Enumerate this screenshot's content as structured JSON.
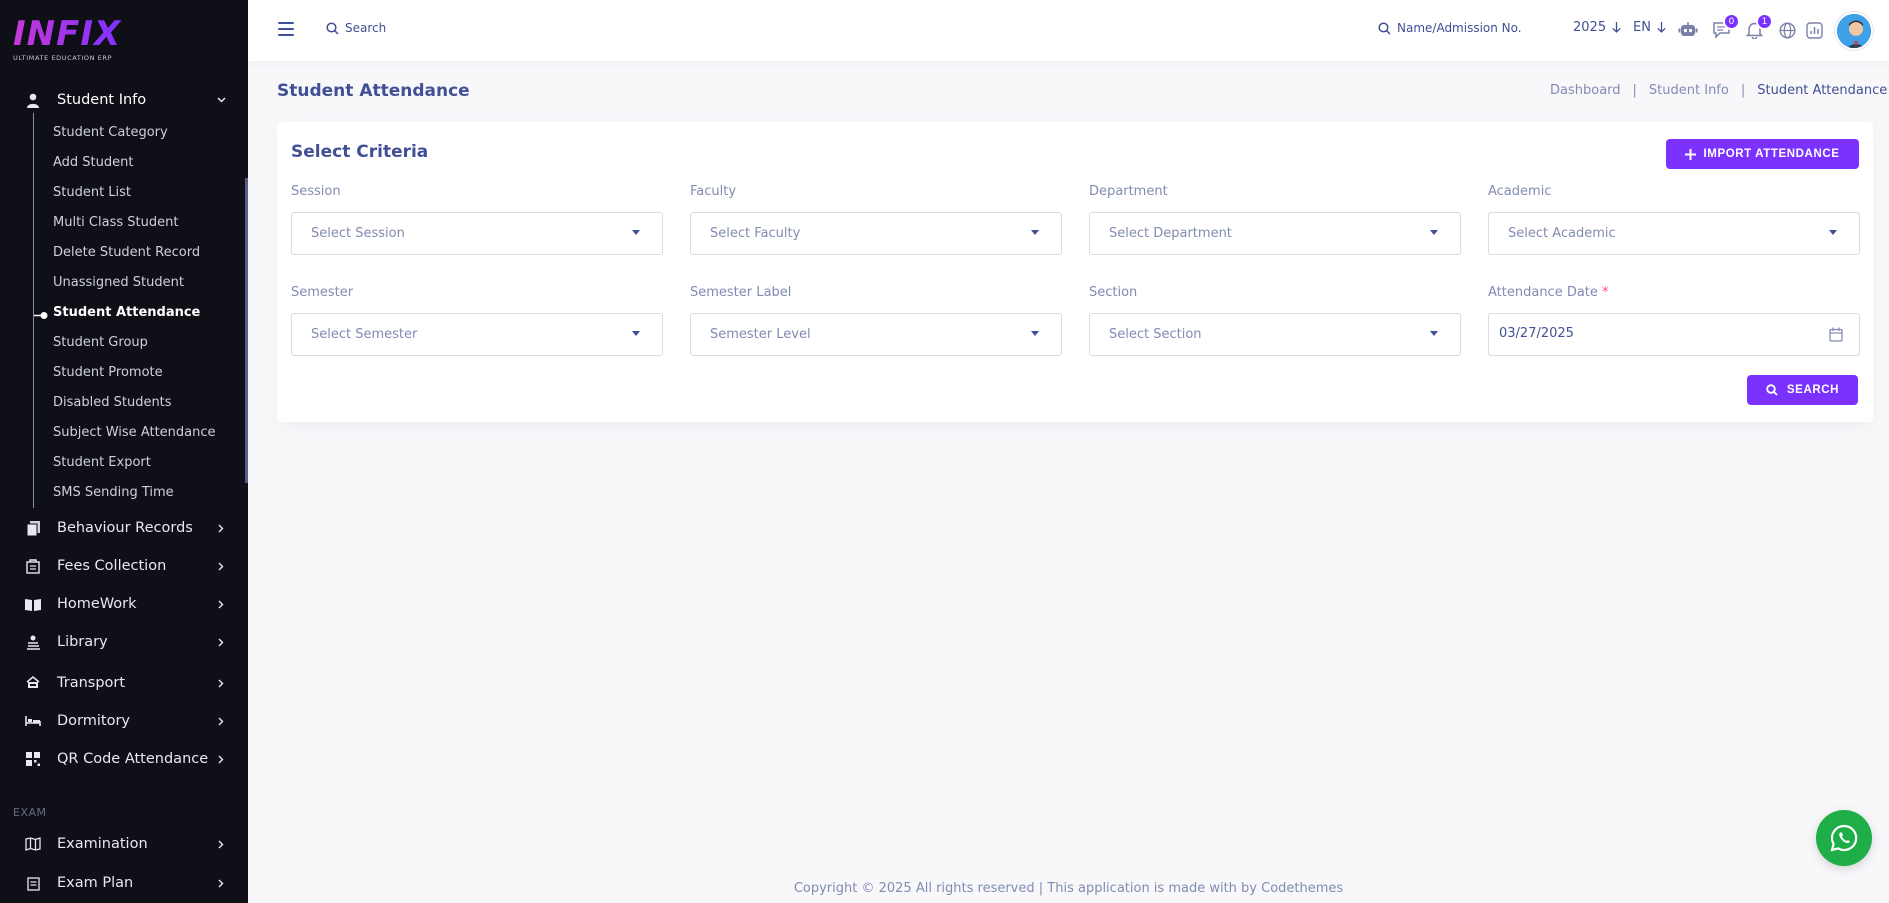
{
  "logo": {
    "text": "INFIX",
    "subtitle": "ULTIMATE EDUCATION ERP"
  },
  "sidebar": {
    "student_info": {
      "label": "Student Info",
      "icon": "user-icon"
    },
    "sub_items": [
      "Student Category",
      "Add Student",
      "Student List",
      "Multi Class Student",
      "Delete Student Record",
      "Unassigned Student",
      "Student Attendance",
      "Student Group",
      "Student Promote",
      "Disabled Students",
      "Subject Wise Attendance",
      "Student Export",
      "SMS Sending Time"
    ],
    "active_sub_item": "Student Attendance",
    "menus": [
      {
        "label": "Behaviour Records",
        "icon": "files-icon"
      },
      {
        "label": "Fees Collection",
        "icon": "receipt-icon"
      },
      {
        "label": "HomeWork",
        "icon": "book-icon"
      },
      {
        "label": "Library",
        "icon": "library-icon"
      },
      {
        "label": "Transport",
        "icon": "bus-icon"
      },
      {
        "label": "Dormitory",
        "icon": "bed-icon"
      },
      {
        "label": "QR Code Attendance",
        "icon": "qrcode-icon"
      }
    ],
    "section_exam": "EXAM",
    "exam_menus": [
      {
        "label": "Examination",
        "icon": "map-icon"
      },
      {
        "label": "Exam Plan",
        "icon": "clipboard-icon"
      }
    ]
  },
  "header": {
    "search_placeholder": "Search",
    "name_search_placeholder": "Name/Admission No.",
    "year": "2025",
    "language": "EN",
    "chat_count": "0",
    "notification_count": "1"
  },
  "page": {
    "title": "Student Attendance",
    "breadcrumb": [
      "Dashboard",
      "Student Info",
      "Student Attendance"
    ]
  },
  "criteria": {
    "title": "Select Criteria",
    "import_button": "IMPORT ATTENDANCE",
    "search_button": "SEARCH",
    "fields": {
      "session": {
        "label": "Session",
        "value": "Select Session"
      },
      "faculty": {
        "label": "Faculty",
        "value": "Select Faculty"
      },
      "department": {
        "label": "Department",
        "value": "Select Department"
      },
      "academic": {
        "label": "Academic",
        "value": "Select Academic"
      },
      "semester": {
        "label": "Semester",
        "value": "Select Semester"
      },
      "semester_label": {
        "label": "Semester Label",
        "value": "Semester Level"
      },
      "section": {
        "label": "Section",
        "value": "Select Section"
      },
      "attendance_date": {
        "label": "Attendance Date",
        "required_mark": "*",
        "value": "03/27/2025"
      }
    }
  },
  "footer": {
    "text": "Copyright © 2025 All rights reserved | This application is made with by Codethemes"
  },
  "colors": {
    "primary": "#7c32ff",
    "text": "#415094",
    "muted": "#828bb2",
    "sidebar_bg": "#0f0f17",
    "whatsapp": "#1ead47"
  }
}
